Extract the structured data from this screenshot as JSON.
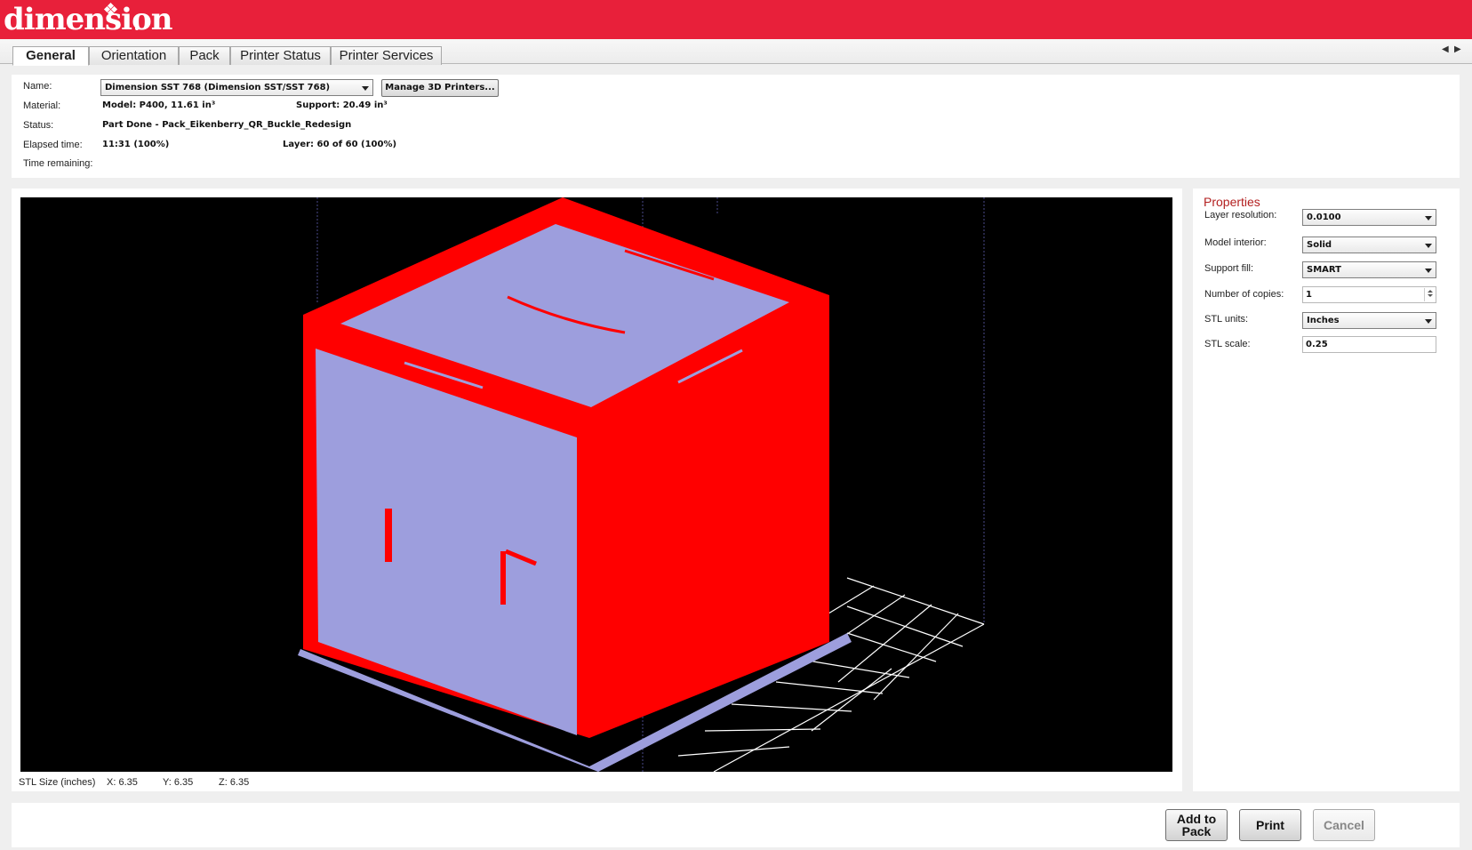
{
  "app": {
    "logo": "dimension"
  },
  "tabs": [
    {
      "label": "General",
      "active": true
    },
    {
      "label": "Orientation"
    },
    {
      "label": "Pack"
    },
    {
      "label": "Printer Status"
    },
    {
      "label": "Printer Services"
    }
  ],
  "info": {
    "name_label": "Name:",
    "printer_select": "Dimension SST 768  (Dimension SST/SST 768)",
    "manage_button": "Manage 3D Printers...",
    "material_label": "Material:",
    "model_value": "Model: P400, 11.61 in³",
    "support_value": "Support:  20.49 in³",
    "status_label": "Status:",
    "status_value": "Part  Done  -  Pack_Eikenberry_QR_Buckle_Redesign",
    "elapsed_label": "Elapsed time:",
    "elapsed_value": "11:31  (100%)",
    "layer_value": "Layer: 60 of 60  (100%)",
    "remaining_label": "Time remaining:"
  },
  "stl_size": {
    "label": "STL Size (inches)",
    "x": "X:  6.35",
    "y": "Y:  6.35",
    "z": "Z:  6.35"
  },
  "properties": {
    "title": "Properties",
    "layer_resolution_label": "Layer resolution:",
    "layer_resolution_value": "0.0100",
    "model_interior_label": "Model interior:",
    "model_interior_value": "Solid",
    "support_fill_label": "Support fill:",
    "support_fill_value": "SMART",
    "copies_label": "Number of copies:",
    "copies_value": "1",
    "stl_units_label": "STL units:",
    "stl_units_value": "Inches",
    "stl_scale_label": "STL scale:",
    "stl_scale_value": "0.25"
  },
  "actions": {
    "add_to_pack": "Add to Pack",
    "print": "Print",
    "cancel": "Cancel"
  },
  "colors": {
    "brand_red": "#e8203a",
    "model_red": "#ff0000",
    "model_lavender": "#9d9edd",
    "viewport_bg": "#000000"
  }
}
